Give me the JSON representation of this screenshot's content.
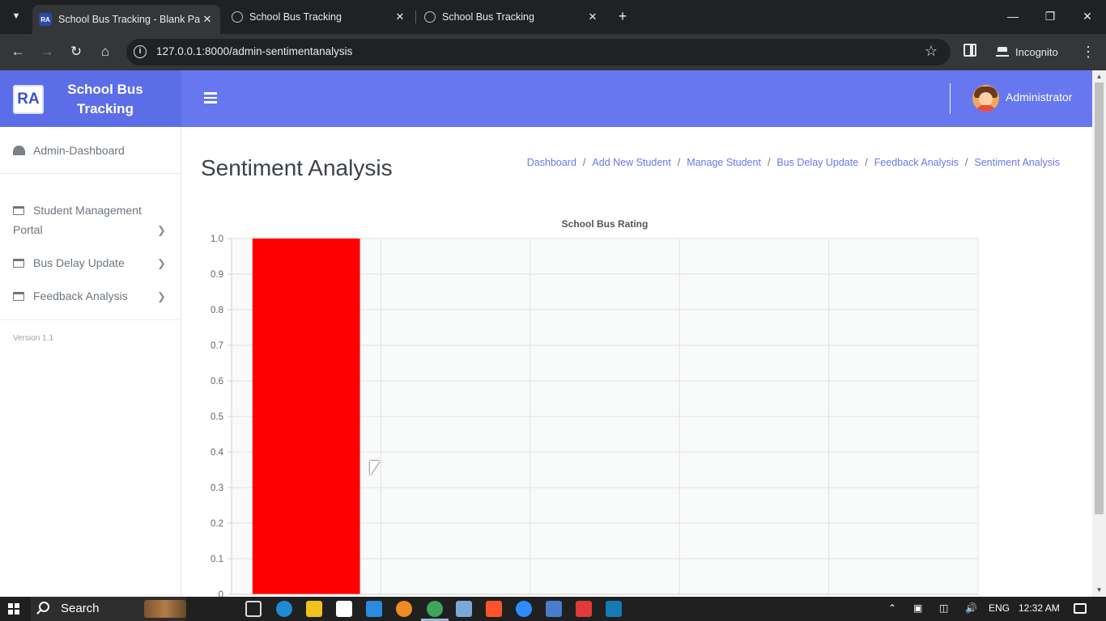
{
  "browser": {
    "tabs": [
      {
        "title": "School Bus Tracking - Blank Pa",
        "active": true,
        "favicon": "ra-logo"
      },
      {
        "title": "School Bus Tracking",
        "active": false,
        "favicon": "globe-icon"
      },
      {
        "title": "School Bus Tracking",
        "active": false,
        "favicon": "globe-icon"
      }
    ],
    "url": "127.0.0.1:8000/admin-sentimentanalysis",
    "incognito_label": "Incognito"
  },
  "app": {
    "logo_text": "RA",
    "brand_name": "School Bus Tracking",
    "user_name": "Administrator",
    "primary_color": "#6777ef",
    "brand_color": "#5b6ee8"
  },
  "sidebar": {
    "items": [
      {
        "label": "Admin-Dashboard",
        "icon": "gauge-icon"
      },
      {
        "label": "Student Management Portal",
        "icon": "window-icon",
        "has_chevron": true
      },
      {
        "label": "Bus Delay Update",
        "icon": "window-icon",
        "has_chevron": true
      },
      {
        "label": "Feedback Analysis",
        "icon": "window-icon",
        "has_chevron": true
      }
    ],
    "version": "Version 1.1"
  },
  "page": {
    "title": "Sentiment Analysis",
    "breadcrumb": [
      "Dashboard",
      "Add New Student",
      "Manage Student",
      "Bus Delay Update",
      "Feedback Analysis",
      "Sentiment Analysis"
    ]
  },
  "chart_data": {
    "type": "bar",
    "title": "School Bus Rating",
    "categories": [
      "",
      "",
      "",
      "",
      ""
    ],
    "values": [
      1.0,
      0,
      0,
      0,
      0
    ],
    "bar_color": "#ff0000",
    "ylim": [
      0,
      1.0
    ],
    "yticks": [
      "0",
      "0.1",
      "0.2",
      "0.3",
      "0.4",
      "0.5",
      "0.6",
      "0.7",
      "0.8",
      "0.9",
      "1.0"
    ],
    "grid": true,
    "xlabel": "",
    "ylabel": ""
  },
  "taskbar": {
    "search_label": "Search",
    "language": "ENG",
    "time": "12:32 AM"
  }
}
